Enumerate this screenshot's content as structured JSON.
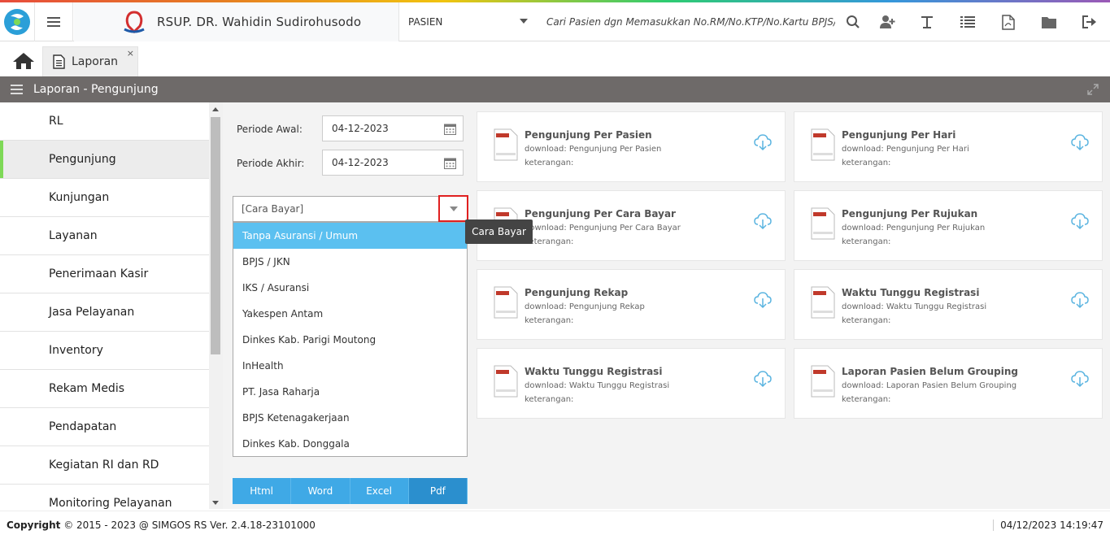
{
  "brand": {
    "title": "RSUP. DR. Wahidin Sudirohusodo"
  },
  "navbar": {
    "category": "PASIEN",
    "search_placeholder": "Cari Pasien dgn Memasukkan No.RM/No.KTP/No.Kartu BPJS/",
    "icons": [
      "search-icon",
      "add-user-icon",
      "text-icon",
      "list-icon",
      "pdf-icon",
      "folder-icon",
      "logout-icon"
    ]
  },
  "tabs": [
    {
      "label": "Laporan",
      "close": "×"
    }
  ],
  "panel": {
    "title": "Laporan - Pengunjung"
  },
  "sidebar": {
    "items": [
      {
        "label": "RL"
      },
      {
        "label": "Pengunjung"
      },
      {
        "label": "Kunjungan"
      },
      {
        "label": "Layanan"
      },
      {
        "label": "Penerimaan Kasir"
      },
      {
        "label": "Jasa Pelayanan"
      },
      {
        "label": "Inventory"
      },
      {
        "label": "Rekam Medis"
      },
      {
        "label": "Pendapatan"
      },
      {
        "label": "Kegiatan RI dan RD"
      },
      {
        "label": "Monitoring Pelayanan"
      }
    ],
    "active": "Pengunjung"
  },
  "form": {
    "periode_awal_label": "Periode Awal:",
    "periode_awal_value": "04-12-2023",
    "periode_akhir_label": "Periode Akhir:",
    "periode_akhir_value": "04-12-2023",
    "cara_bayar_placeholder": "[Cara Bayar]",
    "tooltip": "Cara Bayar",
    "options": [
      {
        "label": "Tanpa Asuransi / Umum"
      },
      {
        "label": "BPJS / JKN"
      },
      {
        "label": "IKS / Asuransi"
      },
      {
        "label": "Yakespen Antam"
      },
      {
        "label": "Dinkes Kab. Parigi Moutong"
      },
      {
        "label": "InHealth"
      },
      {
        "label": "PT. Jasa Raharja"
      },
      {
        "label": "BPJS Ketenagakerjaan"
      },
      {
        "label": "Dinkes Kab. Donggala"
      }
    ],
    "highlighted_option": "Tanpa Asuransi / Umum",
    "export_buttons": [
      {
        "label": "Html"
      },
      {
        "label": "Word"
      },
      {
        "label": "Excel"
      },
      {
        "label": "Pdf"
      }
    ],
    "active_export": "Pdf"
  },
  "reports": [
    {
      "title": "Pengunjung Per Pasien",
      "download": "download: Pengunjung Per Pasien",
      "keterangan": "keterangan:"
    },
    {
      "title": "Pengunjung Per Hari",
      "download": "download: Pengunjung Per Hari",
      "keterangan": "keterangan:"
    },
    {
      "title": "Pengunjung Per Cara Bayar",
      "download": "download: Pengunjung Per Cara Bayar",
      "keterangan": "keterangan:"
    },
    {
      "title": "Pengunjung Per Rujukan",
      "download": "download: Pengunjung Per Rujukan",
      "keterangan": "keterangan:"
    },
    {
      "title": "Pengunjung Rekap",
      "download": "download: Pengunjung Rekap",
      "keterangan": "keterangan:"
    },
    {
      "title": "Waktu Tunggu Registrasi",
      "download": "download: Waktu Tunggu Registrasi",
      "keterangan": "keterangan:"
    },
    {
      "title": "Waktu Tunggu Registrasi",
      "download": "download: Waktu Tunggu Registrasi",
      "keterangan": "keterangan:"
    },
    {
      "title": "Laporan Pasien Belum Grouping",
      "download": "download: Laporan Pasien Belum Grouping",
      "keterangan": "keterangan:"
    }
  ],
  "footer": {
    "copyright_label": "Copyright",
    "copyright_text": "2015 - 2023 @ SIMGOS RS Ver. 2.4.18-23101000",
    "datetime": "04/12/2023 14:19:47"
  },
  "colors": {
    "accent": "#3fa9e6",
    "highlight": "#5bc0f0",
    "panel_header": "#6e6a69",
    "active_marker": "#7ed957",
    "focus_border": "#e02020"
  }
}
